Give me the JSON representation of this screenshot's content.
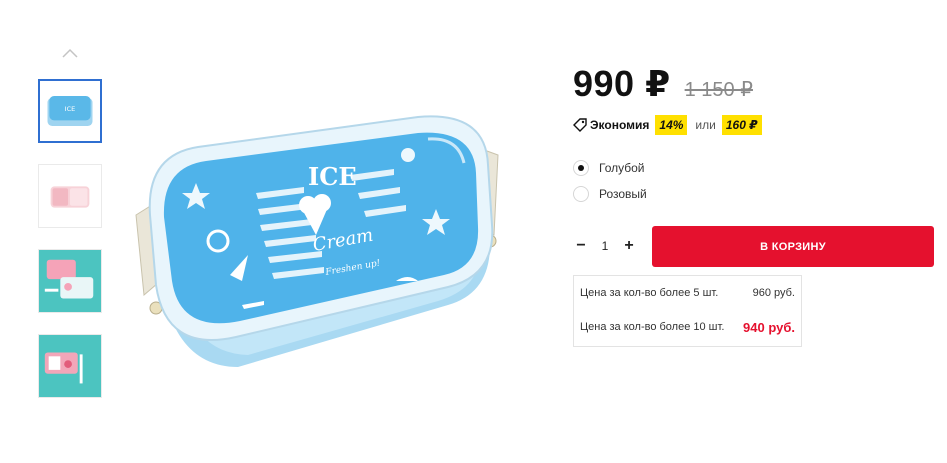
{
  "gallery": {
    "up_icon": "chevron-up-icon",
    "thumbnails": [
      {
        "name": "thumb-blue",
        "active": true
      },
      {
        "name": "thumb-pink",
        "active": false
      },
      {
        "name": "thumb-teal-1",
        "active": false
      },
      {
        "name": "thumb-teal-2",
        "active": false
      }
    ],
    "main_image": {
      "lid_text_1": "ICE",
      "lid_text_2": "Cream",
      "lid_text_3": "Freshen up!"
    }
  },
  "price": {
    "current": "990 ₽",
    "old": "1 150 ₽"
  },
  "economy": {
    "icon": "tag-icon",
    "label": "Экономия",
    "percent": "14%",
    "or": "или",
    "amount": "160 ₽"
  },
  "variants": [
    {
      "label": "Голубой",
      "checked": true
    },
    {
      "label": "Розовый",
      "checked": false
    }
  ],
  "quantity": {
    "minus": "−",
    "value": "1",
    "plus": "+"
  },
  "cart_button": "В КОРЗИНУ",
  "bulk_prices": [
    {
      "label": "Цена за кол-во более 5 шт.",
      "price": "960 руб."
    },
    {
      "label": "Цена за кол-во более 10 шт.",
      "price": "940 руб."
    }
  ],
  "colors": {
    "accent_red": "#e5112e",
    "badge_yellow": "#ffe000",
    "active_thumb_border": "#2f6fd1"
  }
}
